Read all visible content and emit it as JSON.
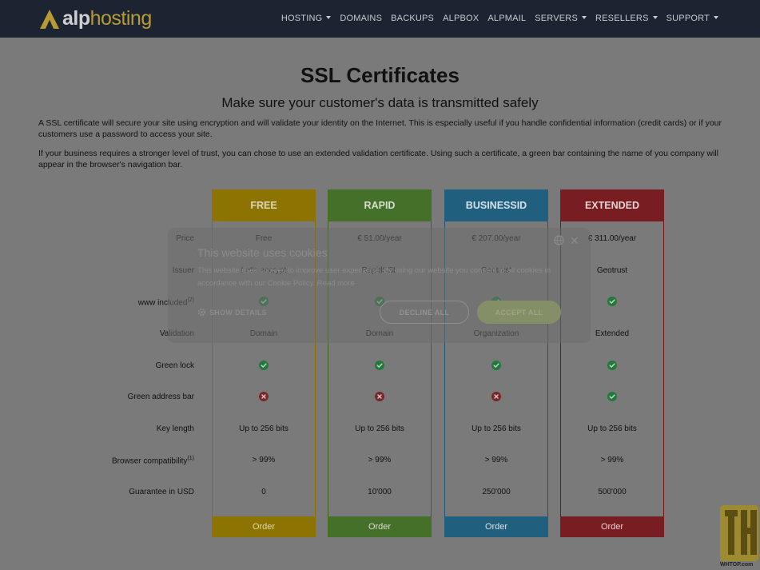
{
  "nav": {
    "logo_primary": "alp",
    "logo_secondary": "hosting",
    "items": [
      {
        "label": "HOSTING",
        "dropdown": true
      },
      {
        "label": "DOMAINS",
        "dropdown": false
      },
      {
        "label": "BACKUPS",
        "dropdown": false
      },
      {
        "label": "ALPBOX",
        "dropdown": false
      },
      {
        "label": "ALPMAIL",
        "dropdown": false
      },
      {
        "label": "SERVERS",
        "dropdown": true
      },
      {
        "label": "RESELLERS",
        "dropdown": true
      },
      {
        "label": "SUPPORT",
        "dropdown": true
      }
    ]
  },
  "page": {
    "title": "SSL Certificates",
    "subtitle": "Make sure your customer's data is transmitted safely",
    "intro1": "A SSL certificate will secure your site using encryption and will validate your identity on the Internet. This is especially useful if you handle confidential information (credit cards) or if your customers use a password to access your site.",
    "intro2": "If your business requires a stronger level of trust, you can chose to use an extended validation certificate. Using such a certificate, a green bar containing the name of you company will appear in the browser's navigation bar."
  },
  "table": {
    "rows": [
      {
        "label": "Price",
        "sup": ""
      },
      {
        "label": "Issuer",
        "sup": ""
      },
      {
        "label": "www included",
        "sup": "(2)"
      },
      {
        "label": "Validation",
        "sup": ""
      },
      {
        "label": "Green lock",
        "sup": ""
      },
      {
        "label": "Green address bar",
        "sup": ""
      },
      {
        "label": "Key length",
        "sup": ""
      },
      {
        "label": "Browser compatibility",
        "sup": "(1)"
      },
      {
        "label": "Guarantee in USD",
        "sup": ""
      }
    ],
    "plans": [
      {
        "name": "FREE",
        "order_label": "Order",
        "cells": [
          "Free",
          "Let's encrypt",
          "check",
          "Domain",
          "check",
          "cross",
          "Up to 256 bits",
          "> 99%",
          "0"
        ]
      },
      {
        "name": "RAPID",
        "order_label": "Order",
        "cells": [
          "€ 51.00/year",
          "RapidSSL",
          "check",
          "Domain",
          "check",
          "cross",
          "Up to 256 bits",
          "> 99%",
          "10'000"
        ]
      },
      {
        "name": "BUSINESSID",
        "order_label": "Order",
        "cells": [
          "€ 207.00/year",
          "Geotrust",
          "check",
          "Organization",
          "check",
          "cross",
          "Up to 256 bits",
          "> 99%",
          "250'000"
        ]
      },
      {
        "name": "EXTENDED",
        "order_label": "Order",
        "cells": [
          "€ 311.00/year",
          "Geotrust",
          "check",
          "Extended",
          "check",
          "check",
          "Up to 256 bits",
          "> 99%",
          "500'000"
        ]
      }
    ]
  },
  "cookie": {
    "title": "This website uses cookies",
    "text": "This website uses cookies to improve user experience. By using our website you consent to all cookies in accordance with our Cookie Policy.",
    "read_more": "Read more",
    "show_details": "SHOW DETAILS",
    "decline": "DECLINE ALL",
    "accept": "ACCEPT ALL"
  },
  "badge": {
    "text": "WHTOP.com"
  },
  "colors": {
    "free": "#8d7402",
    "rapid": "#45702a",
    "businessid": "#215f7e",
    "extended": "#781d21",
    "check": "#1f7a3c",
    "cross": "#7a2626"
  }
}
